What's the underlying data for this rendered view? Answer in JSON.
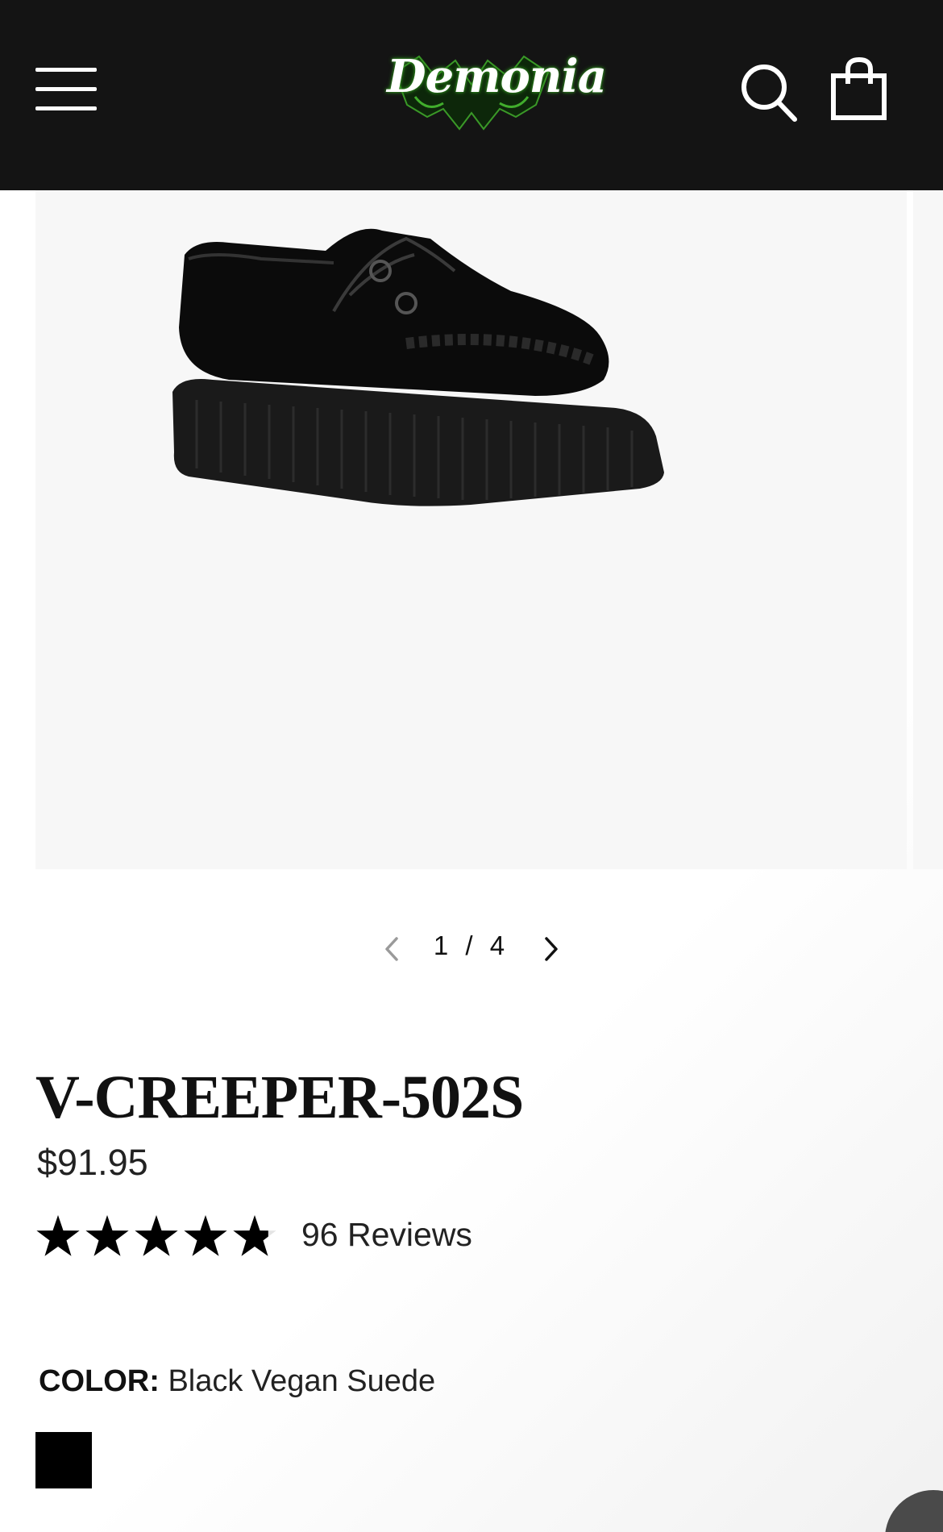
{
  "header": {
    "logo_text": "Demonia",
    "menu_icon": "hamburger-menu-icon",
    "search_icon": "search-icon",
    "cart_icon": "shopping-bag-icon",
    "background_color": "#141414",
    "logo_glow_color": "#2e8b1e"
  },
  "gallery": {
    "image_subject": "black suede creeper shoe",
    "pagination": {
      "current": "1",
      "total": "4",
      "text": "1 / 4",
      "prev_icon": "chevron-left-icon",
      "next_icon": "chevron-right-icon"
    }
  },
  "product": {
    "title": "V-CREEPER-502S",
    "price": "$91.95",
    "rating": {
      "stars_out_of_5": 4.8,
      "reviews_text": "96 Reviews"
    },
    "color": {
      "label": "COLOR:",
      "value": "Black Vegan Suede",
      "swatches": [
        {
          "name": "Black Vegan Suede",
          "hex": "#000000",
          "selected": true
        }
      ]
    }
  }
}
